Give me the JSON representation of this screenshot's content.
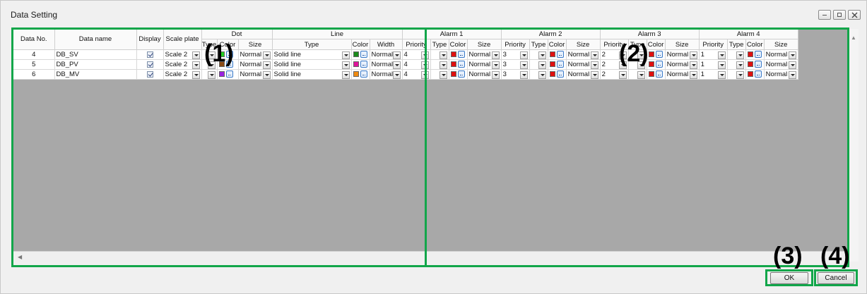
{
  "window": {
    "title": "Data Setting"
  },
  "headers": {
    "data_no": "Data No.",
    "data_name": "Data name",
    "display": "Display",
    "scale_plate": "Scale plate",
    "dot": "Dot",
    "dot_type": "Type",
    "dot_color": "Color",
    "dot_size": "Size",
    "line": "Line",
    "line_type": "Type",
    "line_color": "Color",
    "line_width": "Width",
    "alarms": [
      "Alarm 1",
      "Alarm 2",
      "Alarm 3",
      "Alarm 4"
    ],
    "alarm_priority": "Priority",
    "alarm_type": "Type",
    "alarm_color": "Color",
    "alarm_size": "Size"
  },
  "rows": [
    {
      "no": "4",
      "name": "DB_SV",
      "scale": "Scale 2",
      "dot_color": "#22cc22",
      "dot_size": "Normal",
      "line_type": "Solid line",
      "line_color": "#1a8a1a",
      "line_width": "Normal",
      "alarms": [
        {
          "priority": "4",
          "size": "Normal"
        },
        {
          "priority": "3",
          "size": "Normal"
        },
        {
          "priority": "2",
          "size": "Normal"
        },
        {
          "priority": "1",
          "size": "Normal"
        }
      ]
    },
    {
      "no": "5",
      "name": "DB_PV",
      "scale": "Scale 2",
      "dot_color": "#8b4a14",
      "dot_size": "Normal",
      "line_type": "Solid line",
      "line_color": "#e0149a",
      "line_width": "Normal",
      "alarms": [
        {
          "priority": "4",
          "size": "Normal"
        },
        {
          "priority": "3",
          "size": "Normal"
        },
        {
          "priority": "2",
          "size": "Normal"
        },
        {
          "priority": "1",
          "size": "Normal"
        }
      ]
    },
    {
      "no": "6",
      "name": "DB_MV",
      "scale": "Scale 2",
      "dot_color": "#9a22e0",
      "dot_size": "Normal",
      "line_type": "Solid line",
      "line_color": "#f08a10",
      "line_width": "Normal",
      "alarms": [
        {
          "priority": "4",
          "size": "Normal"
        },
        {
          "priority": "3",
          "size": "Normal"
        },
        {
          "priority": "2",
          "size": "Normal"
        },
        {
          "priority": "1",
          "size": "Normal"
        }
      ]
    }
  ],
  "alarm_color": "#e01010",
  "callouts": {
    "c1": "(1)",
    "c2": "(2)",
    "c3": "(3)",
    "c4": "(4)"
  },
  "buttons": {
    "ok": "OK",
    "cancel": "Cancel"
  },
  "highlight_color": "#12a64a"
}
